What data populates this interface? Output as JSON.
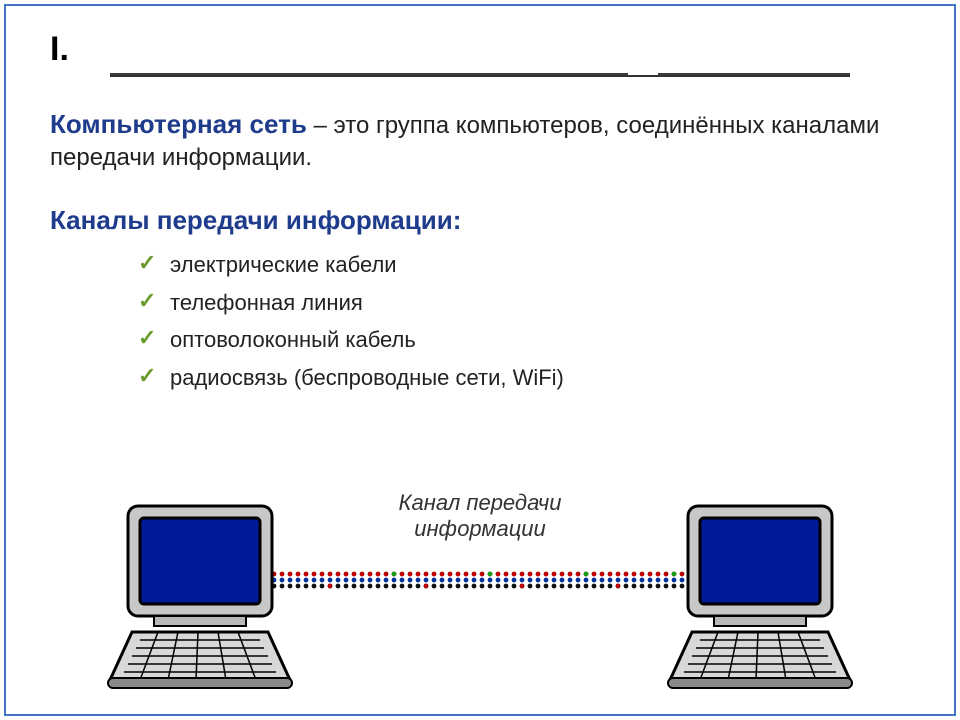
{
  "slide": {
    "number": "I.",
    "term": "Компьютерная сеть",
    "definition_rest": " – это группа компьютеров, соединённых каналами передачи информации.",
    "channels_heading": "Каналы передачи информации:",
    "channels": [
      "электрические кабели",
      "телефонная линия",
      "оптоволоконный кабель",
      "радиосвязь (беспроводные сети, WiFi)"
    ],
    "diagram": {
      "channel_label_line1": "Канал передачи",
      "channel_label_line2": "информации"
    }
  }
}
